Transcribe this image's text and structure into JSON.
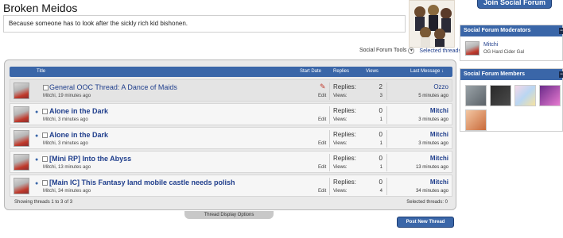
{
  "group": {
    "title": "Broken Meidos",
    "description": "Because someone has to look after the sickly rich kid bishonen."
  },
  "tools": {
    "social_tools_label": "Social Forum Tools",
    "selected_label": "Selected threads:",
    "selected_count": "0"
  },
  "thread_header": {
    "title": "Title",
    "start_date": "Start Date",
    "replies": "Replies",
    "views": "Views",
    "last_message": "Last Message ↓"
  },
  "threads": [
    {
      "title": "General OOC Thread: A Dance of Maids",
      "meta": "Mitchi, 19 minutes ago",
      "edit": "Edit",
      "replies_label": "Replies:",
      "replies": "2",
      "views_label": "Views:",
      "views": "3",
      "last_user": "Ozzo",
      "last_time": "5 minutes ago"
    },
    {
      "title": "Alone in the Dark",
      "meta": "Mitchi, 3 minutes ago",
      "edit": "Edit",
      "replies_label": "Replies:",
      "replies": "0",
      "views_label": "Views:",
      "views": "1",
      "last_user": "Mitchi",
      "last_time": "3 minutes ago"
    },
    {
      "title": "Alone in the Dark",
      "meta": "Mitchi, 3 minutes ago",
      "edit": "Edit",
      "replies_label": "Replies:",
      "replies": "0",
      "views_label": "Views:",
      "views": "1",
      "last_user": "Mitchi",
      "last_time": "3 minutes ago"
    },
    {
      "title": "[Mini RP] Into the Abyss",
      "meta": "Mitchi, 13 minutes ago",
      "edit": "Edit",
      "replies_label": "Replies:",
      "replies": "0",
      "views_label": "Views:",
      "views": "1",
      "last_user": "Mitchi",
      "last_time": "13 minutes ago"
    },
    {
      "title": "[Main IC] This Fantasy land mobile castle needs polish",
      "meta": "Mitchi, 34 minutes ago",
      "edit": "Edit",
      "replies_label": "Replies:",
      "replies": "0",
      "views_label": "Views:",
      "views": "4",
      "last_user": "Mitchi",
      "last_time": "34 minutes ago"
    }
  ],
  "footer": {
    "showing": "Showing threads 1 to 3 of 3",
    "selected": "Selected threads: 0",
    "display_options": "Thread Display Options",
    "post_new": "Post New Thread"
  },
  "sidebar": {
    "join_button": "Join Social Forum",
    "moderators_title": "Social Forum Moderators",
    "moderator_name": "Mitchi",
    "moderator_title": "OG Hard Cider Gal",
    "members_title": "Social Forum Members"
  },
  "icons": {
    "bullet": "bullet-icon",
    "pin": "pin-icon",
    "toggle": "collapse-icon"
  },
  "colors": {
    "header_blue": "#3a66a8",
    "link_blue": "#1f3e8c"
  }
}
